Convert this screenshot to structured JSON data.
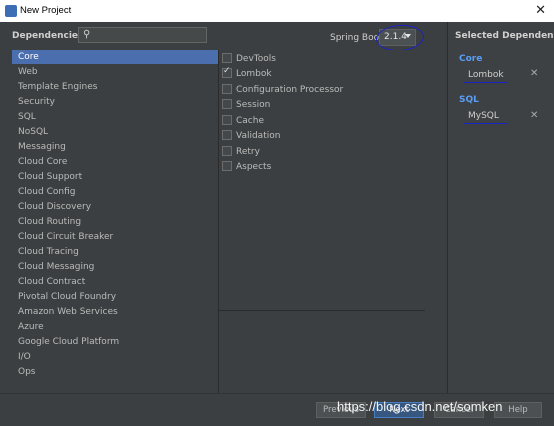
{
  "window": {
    "title": "New Project",
    "close_glyph": "✕"
  },
  "dependencies_label": "Dependencies",
  "search": {
    "value": "",
    "placeholder": ""
  },
  "spring_boot": {
    "label": "Spring Boot",
    "version": "2.1.4"
  },
  "categories": [
    {
      "label": "Core",
      "selected": true
    },
    {
      "label": "Web"
    },
    {
      "label": "Template Engines"
    },
    {
      "label": "Security"
    },
    {
      "label": "SQL"
    },
    {
      "label": "NoSQL"
    },
    {
      "label": "Messaging"
    },
    {
      "label": "Cloud Core"
    },
    {
      "label": "Cloud Support"
    },
    {
      "label": "Cloud Config"
    },
    {
      "label": "Cloud Discovery"
    },
    {
      "label": "Cloud Routing"
    },
    {
      "label": "Cloud Circuit Breaker"
    },
    {
      "label": "Cloud Tracing"
    },
    {
      "label": "Cloud Messaging"
    },
    {
      "label": "Cloud Contract"
    },
    {
      "label": "Pivotal Cloud Foundry"
    },
    {
      "label": "Amazon Web Services"
    },
    {
      "label": "Azure"
    },
    {
      "label": "Google Cloud Platform"
    },
    {
      "label": "I/O"
    },
    {
      "label": "Ops"
    }
  ],
  "dependencies": [
    {
      "label": "DevTools",
      "checked": false
    },
    {
      "label": "Lombok",
      "checked": true
    },
    {
      "label": "Configuration Processor",
      "checked": false
    },
    {
      "label": "Session",
      "checked": false
    },
    {
      "label": "Cache",
      "checked": false
    },
    {
      "label": "Validation",
      "checked": false
    },
    {
      "label": "Retry",
      "checked": false
    },
    {
      "label": "Aspects",
      "checked": false
    }
  ],
  "selected_panel": {
    "title": "Selected Dependencies",
    "groups": [
      {
        "name": "Core",
        "items": [
          {
            "label": "Lombok",
            "remove": "✕"
          }
        ]
      },
      {
        "name": "SQL",
        "items": [
          {
            "label": "MySQL",
            "remove": "✕"
          }
        ]
      }
    ]
  },
  "buttons": {
    "previous": "Previous",
    "next": "Next",
    "cancel": "Cancel",
    "help": "Help"
  },
  "watermark": "https://blog.csdn.net/somken",
  "colors": {
    "selection": "#4b6eaf",
    "group_header": "#589df6",
    "annotation_ink": "#1a23c6"
  },
  "icons": {
    "search": "search-icon",
    "app": "intellij-logo-icon"
  }
}
